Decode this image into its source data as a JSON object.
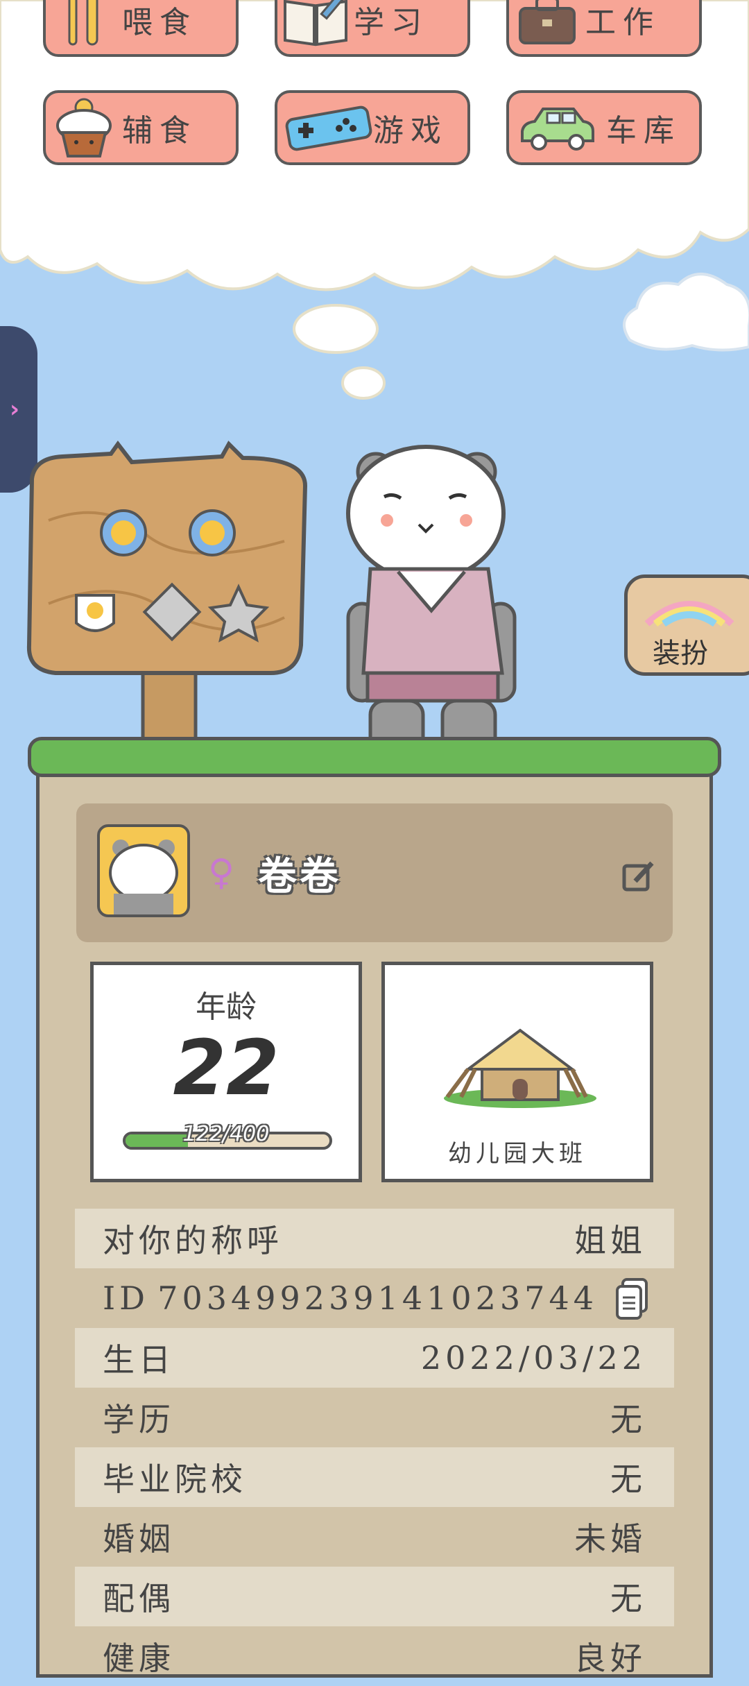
{
  "menu": {
    "row1": [
      {
        "label": "喂食",
        "icon": "fork-knife-icon"
      },
      {
        "label": "学习",
        "icon": "book-icon"
      },
      {
        "label": "工作",
        "icon": "briefcase-icon"
      }
    ],
    "row2": [
      {
        "label": "辅食",
        "icon": "cupcake-icon"
      },
      {
        "label": "游戏",
        "icon": "gamepad-icon"
      },
      {
        "label": "车库",
        "icon": "car-icon"
      }
    ]
  },
  "dress_up": {
    "label": "装扮"
  },
  "profile": {
    "name": "卷卷",
    "gender_symbol": "♀"
  },
  "age": {
    "title": "年龄",
    "value": "22",
    "progress_text": "122/400",
    "progress_fraction": 0.305
  },
  "school": {
    "label": "幼儿园大班"
  },
  "info": [
    {
      "key": "对你的称呼",
      "value": "姐姐"
    },
    {
      "key": "ID",
      "value": "7034992391410237​44"
    },
    {
      "key": "生日",
      "value": "2022/03/22"
    },
    {
      "key": "学历",
      "value": "无"
    },
    {
      "key": "毕业院校",
      "value": "无"
    },
    {
      "key": "婚姻",
      "value": "未婚"
    },
    {
      "key": "配偶",
      "value": "无"
    },
    {
      "key": "健康",
      "value": "良好"
    }
  ],
  "colors": {
    "menu_bg": "#f7a596",
    "sky": "#aed2f4",
    "grass": "#6bb857",
    "panel": "#d2c4a9"
  }
}
